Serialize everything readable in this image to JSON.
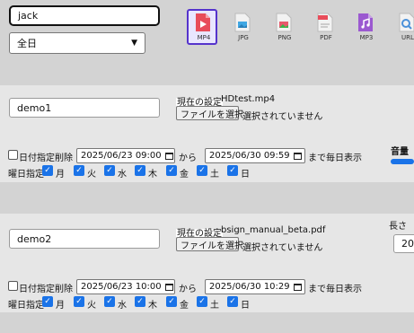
{
  "top": {
    "user_field_value": "jack",
    "period_select_value": "全日"
  },
  "media_types": [
    {
      "label": "MP4",
      "icon": "video-file-icon",
      "color": "#e84c5a",
      "selected": true
    },
    {
      "label": "JPG",
      "icon": "image-file-icon",
      "color": "#40a7e3",
      "selected": false
    },
    {
      "label": "PNG",
      "icon": "image-file-icon",
      "color": "#e8596c",
      "selected": false
    },
    {
      "label": "PDF",
      "icon": "pdf-file-icon",
      "color": "#e84c5a",
      "selected": false
    },
    {
      "label": "MP3",
      "icon": "audio-file-icon",
      "color": "#9b59d0",
      "selected": false
    },
    {
      "label": "URL",
      "icon": "url-file-icon",
      "color": "#4a90d9",
      "selected": false
    }
  ],
  "items": [
    {
      "name": "demo1",
      "current_label": "現在の設定",
      "current_file": "HDtest.mp4",
      "file_button": "ファイルを選択",
      "no_file_text": "選択されていません",
      "date_delete_label": "日付指定削除",
      "start_datetime": "2025/06/23 09:00",
      "from_label": "から",
      "end_datetime": "2025/06/30 09:59",
      "daily_label": "まで毎日表示",
      "weekday_label": "曜日指定",
      "side_label": "音量"
    },
    {
      "name": "demo2",
      "current_label": "現在の設定",
      "current_file": "bsign_manual_beta.pdf",
      "file_button": "ファイルを選択",
      "no_file_text": "選択されていません",
      "date_delete_label": "日付指定削除",
      "start_datetime": "2025/06/23 10:00",
      "from_label": "から",
      "end_datetime": "2025/06/30 10:29",
      "daily_label": "まで毎日表示",
      "weekday_label": "曜日指定",
      "side_label": "長さ",
      "side_value": "20"
    }
  ],
  "weekdays": [
    "月",
    "火",
    "水",
    "木",
    "金",
    "土",
    "日"
  ]
}
